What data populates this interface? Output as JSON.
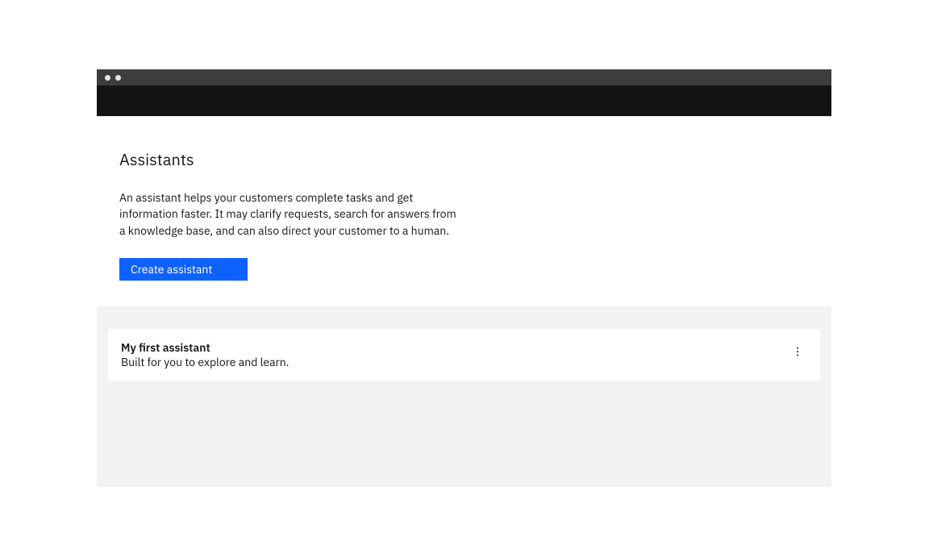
{
  "page": {
    "title": "Assistants",
    "description": "An assistant helps your customers complete tasks and get information faster. It may clarify requests, search for answers from a knowledge base, and can also direct your customer to a human.",
    "create_button_label": "Create assistant"
  },
  "assistants": [
    {
      "name": "My first assistant",
      "description": "Built for you to explore and learn."
    }
  ]
}
